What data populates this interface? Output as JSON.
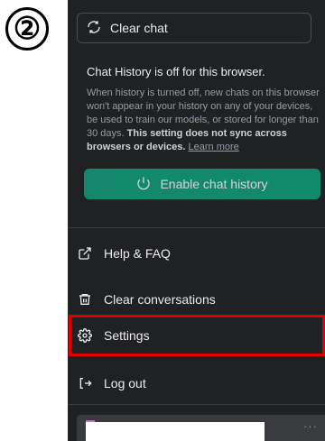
{
  "step_label": "②",
  "sidebar": {
    "clear_chat_label": "Clear chat",
    "history": {
      "title": "Chat History is off for this browser.",
      "desc_plain": "When history is turned off, new chats on this browser won't appear in your history on any of your devices, be used to train our models, or stored for longer than 30 days. ",
      "desc_bold": "This setting does not sync across browsers or devices.",
      "learn_more": "Learn more",
      "enable_label": "Enable chat history"
    },
    "menu": {
      "help": "Help & FAQ",
      "clear_conversations": "Clear conversations",
      "settings": "Settings",
      "logout": "Log out"
    },
    "account_more": "···"
  },
  "colors": {
    "panel_bg": "#202123",
    "accent_green": "#10a37f",
    "highlight_red": "#e00000"
  },
  "icons": [
    "refresh-icon",
    "power-icon",
    "external-link-icon",
    "trash-icon",
    "gear-icon",
    "logout-icon"
  ]
}
